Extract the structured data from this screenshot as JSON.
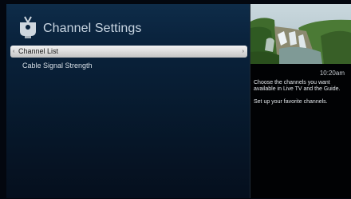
{
  "header": {
    "title": "Channel Settings",
    "logo_icon": "tivo-logo-icon"
  },
  "menu": {
    "items": [
      {
        "label": "Channel List",
        "selected": true
      },
      {
        "label": "Cable Signal Strength",
        "selected": false
      }
    ],
    "left_arrow": "‹",
    "right_arrow": "›"
  },
  "side_panel": {
    "time": "10:20am",
    "description_1": "Choose the channels you want available in Live TV and the Guide.",
    "description_2": "Set up your favorite channels."
  },
  "colors": {
    "background": "#071a2e",
    "selected_item": "#e2e2e2",
    "text": "#d7dfe6"
  }
}
